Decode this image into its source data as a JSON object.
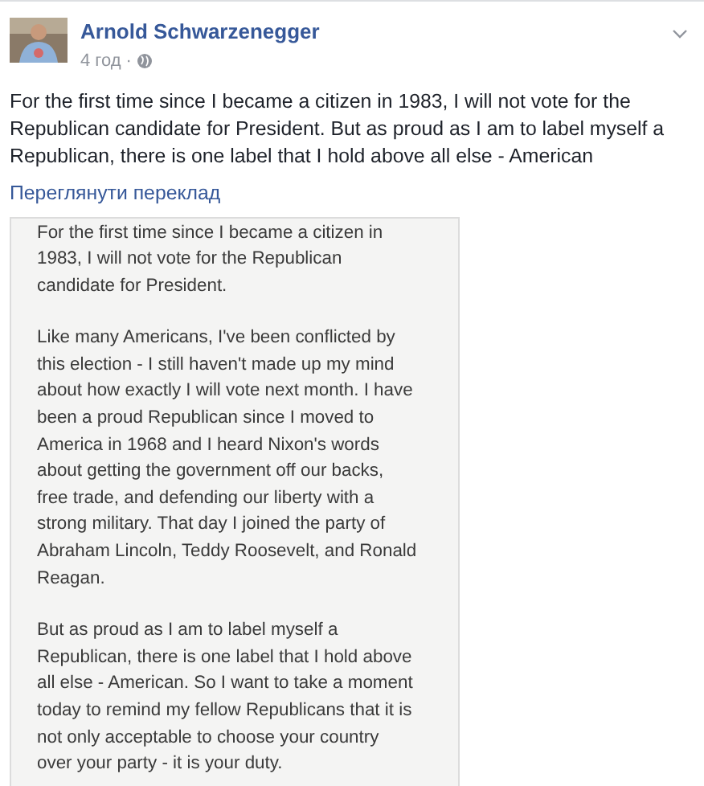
{
  "post": {
    "author": "Arnold Schwarzenegger",
    "time": "4 год",
    "separator": "·",
    "text": "For the first time since I became a citizen in 1983, I will not vote for the Republican candidate for President. But as proud as I am to label myself a Republican, there is one label that I hold above all else - American",
    "translate_link": "Переглянути переклад"
  },
  "note_image": {
    "paragraphs": [
      {
        "lines": [
          "For the first time since I became a citizen in",
          "1983, I will not vote for the Republican",
          "candidate for President."
        ]
      },
      {
        "lines": [
          "Like many Americans, I've been conflicted by",
          "this election - I still haven't made up my mind",
          "about how exactly I will vote next month. I have",
          "been a proud Republican since I moved to",
          "America in 1968 and I heard Nixon's words",
          "about getting the government off our backs,",
          "free trade, and defending our liberty with a",
          "strong military. That day I joined the party of",
          "Abraham Lincoln, Teddy Roosevelt, and Ronald",
          "Reagan."
        ]
      },
      {
        "lines": [
          "But as proud as I am to label myself a",
          "Republican, there is one label that I hold above",
          "all else - American. So I want to take a moment",
          "today to remind my fellow Republicans that it is",
          "not only acceptable to choose your country",
          "over your party - it is your duty."
        ]
      }
    ]
  }
}
